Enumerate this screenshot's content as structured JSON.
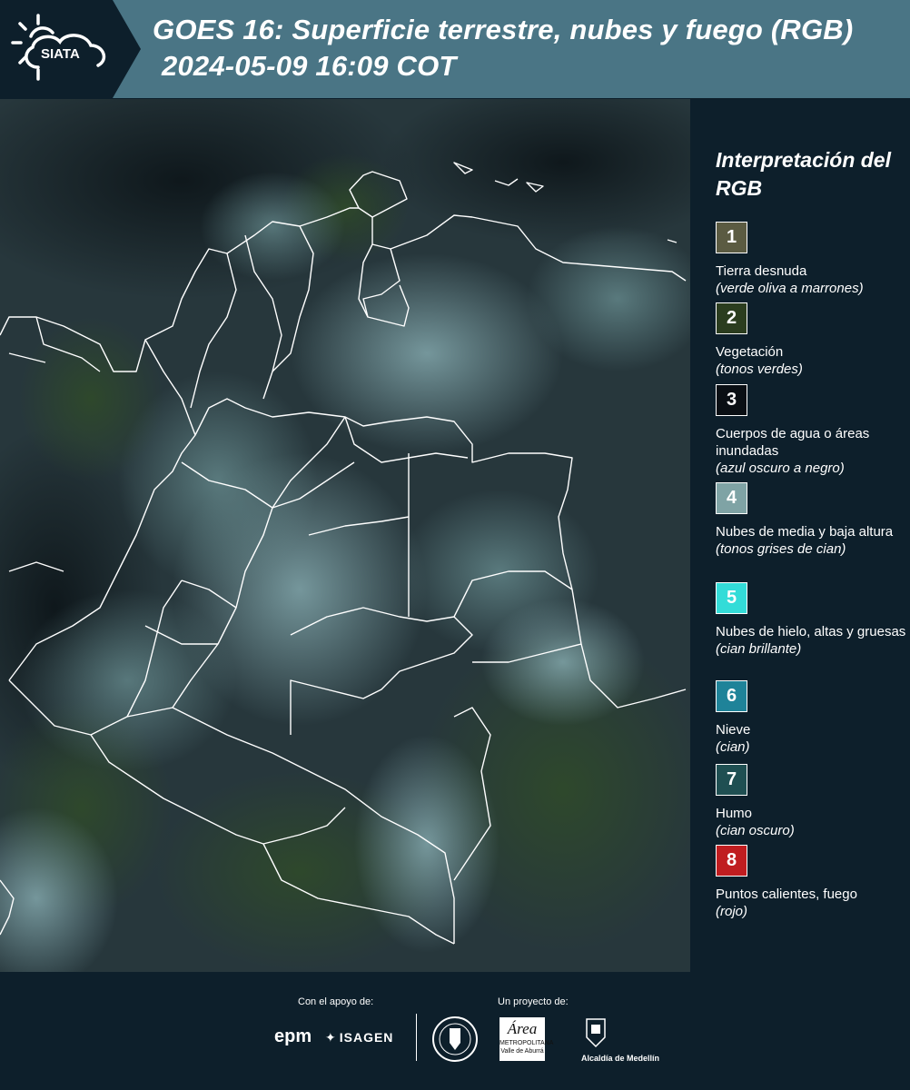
{
  "header": {
    "title_line1": "GOES 16: Superficie terrestre, nubes y fuego (RGB)",
    "title_line2": "2024-05-09 16:09 COT",
    "logo_text": "SIATA"
  },
  "legend": {
    "title": "Interpretación del RGB",
    "items": [
      {
        "number": "1",
        "label": "Tierra desnuda",
        "desc": "(verde oliva a marrones)",
        "color": "#5b5b42"
      },
      {
        "number": "2",
        "label": "Vegetación",
        "desc": "(tonos verdes)",
        "color": "#2b3d1f"
      },
      {
        "number": "3",
        "label": "Cuerpos de agua o áreas inundadas",
        "desc": "(azul oscuro a negro)",
        "color": "#0a0f14"
      },
      {
        "number": "4",
        "label": "Nubes de media y baja altura",
        "desc": "(tonos grises de cian)",
        "color": "#7fa3a5"
      },
      {
        "number": "5",
        "label": "Nubes de hielo, altas y gruesas",
        "desc": "(cian brillante)",
        "color": "#33dcd8"
      },
      {
        "number": "6",
        "label": "Nieve",
        "desc": "(cian)",
        "color": "#1f8399"
      },
      {
        "number": "7",
        "label": "Humo",
        "desc": "(cian oscuro)",
        "color": "#1f4f52"
      },
      {
        "number": "8",
        "label": "Puntos calientes, fuego",
        "desc": "(rojo)",
        "color": "#c01d20"
      }
    ]
  },
  "footer": {
    "support_label": "Con el apoyo de:",
    "project_label": "Un proyecto de:",
    "epm": "epm",
    "isagen": "ISAGEN",
    "area_text": "Área",
    "area_sub": "METROPOLITANA",
    "area_sub2": "Valle de Aburrá",
    "alcaldia": "Alcaldía de Medellín"
  }
}
